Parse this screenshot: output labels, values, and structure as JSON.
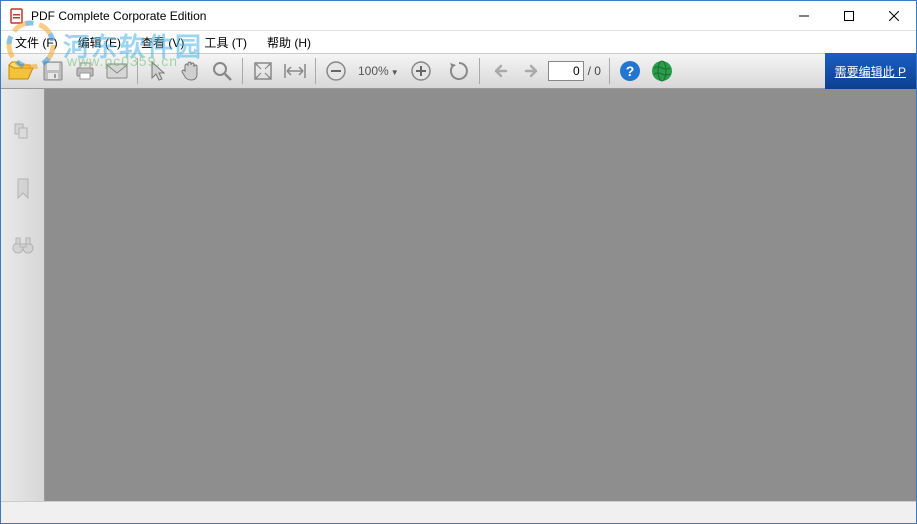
{
  "window": {
    "title": "PDF Complete Corporate Edition"
  },
  "menubar": {
    "file": "文件 (F)",
    "edit": "编辑 (E)",
    "view": "查看 (V)",
    "tools": "工具 (T)",
    "help": "帮助 (H)"
  },
  "toolbar": {
    "zoom_label": "100%",
    "page_value": "0",
    "page_total": "/ 0",
    "edit_banner": "需要编辑此 P"
  },
  "watermark": {
    "text": "河东软件园",
    "url": "www.pc0359.cn"
  }
}
